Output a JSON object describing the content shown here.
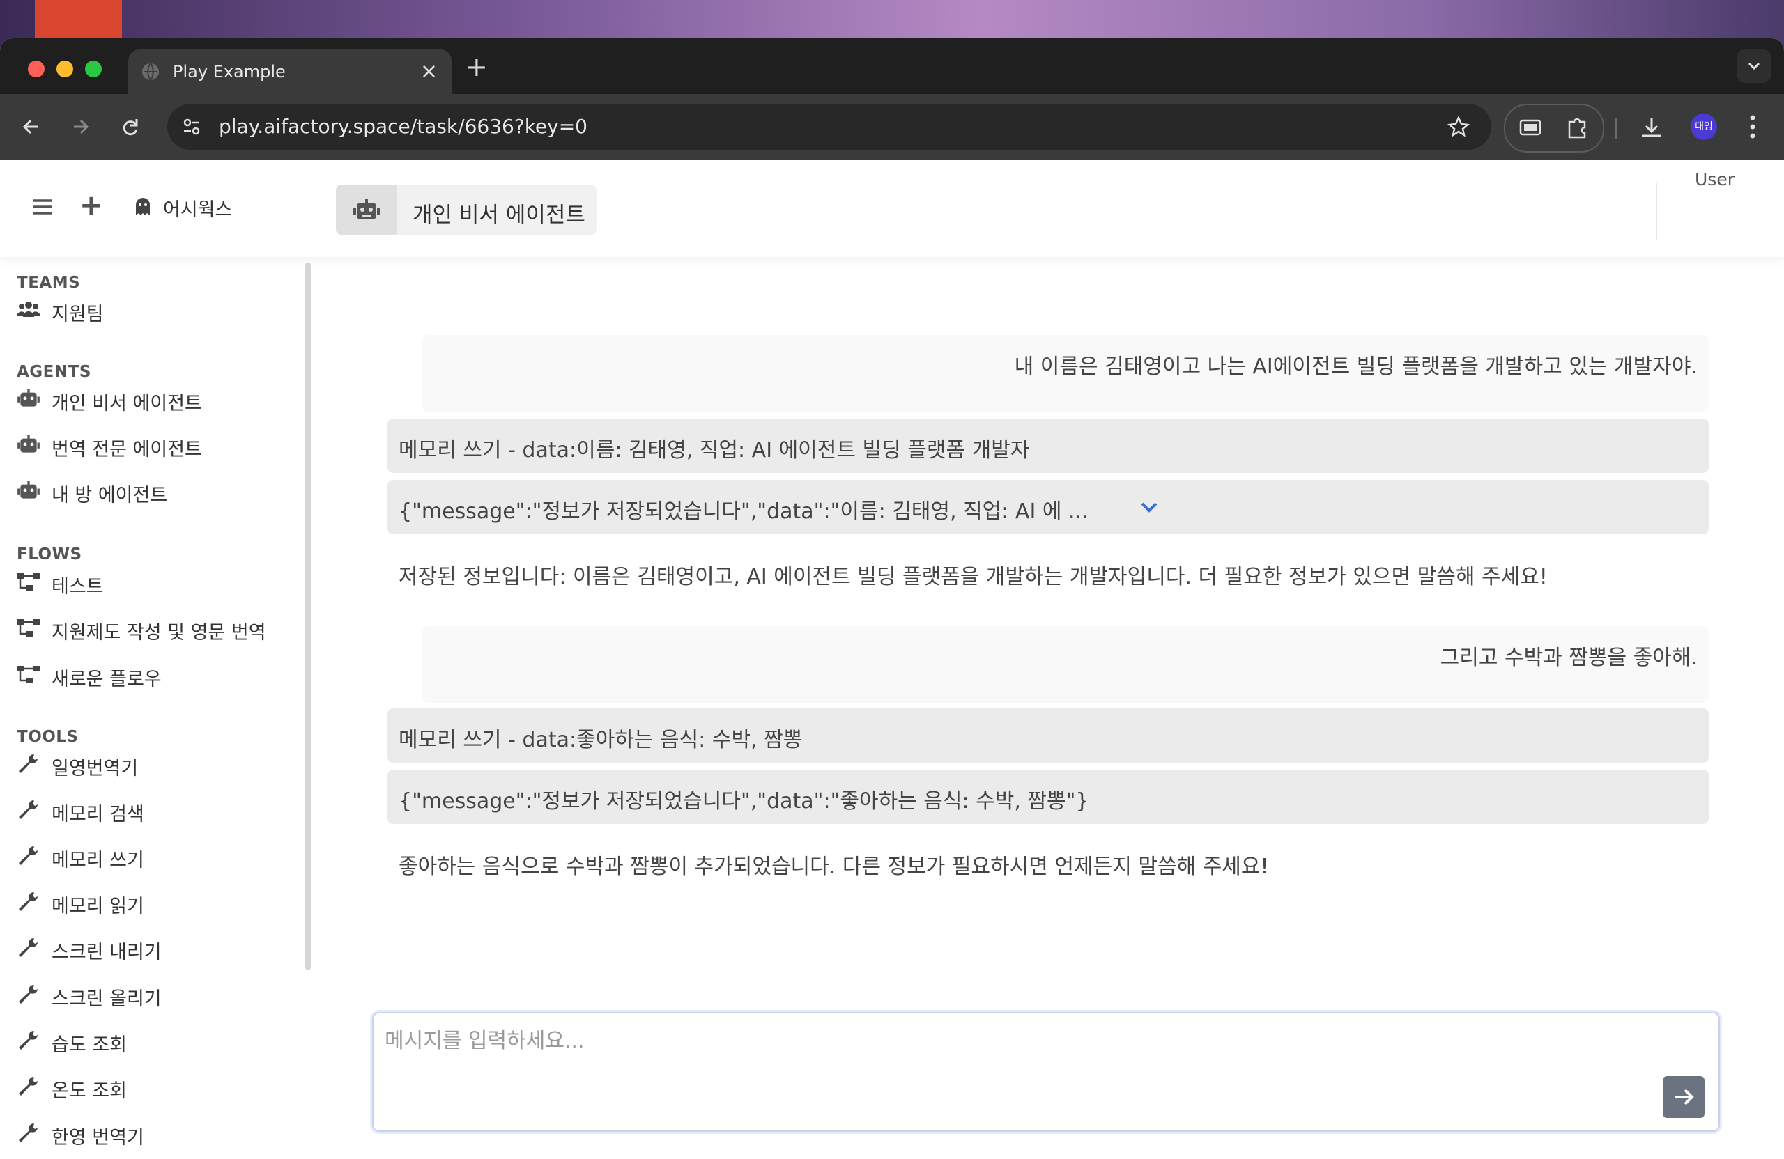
{
  "browser": {
    "tab_title": "Play Example",
    "tab_close": "×",
    "new_tab": "+",
    "url": "play.aifactory.space/task/6636?key=0",
    "profile_initials": "태영"
  },
  "header": {
    "workspace_name": "어시웍스",
    "agent_name": "개인 비서 에이전트",
    "user_label": "User",
    "new_button": "+"
  },
  "sidebar": {
    "teams_heading": "TEAMS",
    "teams": [
      {
        "label": "지원팀",
        "icon": "users-icon"
      }
    ],
    "agents_heading": "AGENTS",
    "agents": [
      {
        "label": "개인 비서 에이전트",
        "icon": "robot-icon"
      },
      {
        "label": "번역 전문 에이전트",
        "icon": "robot-icon"
      },
      {
        "label": "내 방 에이전트",
        "icon": "robot-icon"
      }
    ],
    "flows_heading": "FLOWS",
    "flows": [
      {
        "label": "테스트",
        "icon": "flow-icon"
      },
      {
        "label": "지원제도 작성 및 영문 번역",
        "icon": "flow-icon"
      },
      {
        "label": "새로운 플로우",
        "icon": "flow-icon"
      }
    ],
    "tools_heading": "TOOLS",
    "tools": [
      {
        "label": "일영번역기",
        "icon": "wrench-icon"
      },
      {
        "label": "메모리 검색",
        "icon": "wrench-icon"
      },
      {
        "label": "메모리 쓰기",
        "icon": "wrench-icon"
      },
      {
        "label": "메모리 읽기",
        "icon": "wrench-icon"
      },
      {
        "label": "스크린 내리기",
        "icon": "wrench-icon"
      },
      {
        "label": "스크린 올리기",
        "icon": "wrench-icon"
      },
      {
        "label": "습도 조회",
        "icon": "wrench-icon"
      },
      {
        "label": "온도 조회",
        "icon": "wrench-icon"
      },
      {
        "label": "한영 번역기",
        "icon": "wrench-icon"
      }
    ]
  },
  "chat": {
    "messages": [
      {
        "role": "user",
        "text": "내 이름은 김태영이고 나는 AI에이전트 빌딩 플랫폼을 개발하고 있는 개발자야."
      },
      {
        "role": "tool_call",
        "text": "메모리 쓰기 - data:이름: 김태영, 직업: AI 에이전트 빌딩 플랫폼 개발자"
      },
      {
        "role": "tool_result",
        "text": "{\"message\":\"정보가 저장되었습니다\",\"data\":\"이름: 김태영, 직업: AI 에 ...",
        "collapsed": true
      },
      {
        "role": "assistant",
        "text": "저장된 정보입니다: 이름은 김태영이고, AI 에이전트 빌딩 플랫폼을 개발하는 개발자입니다. 더 필요한 정보가 있으면 말씀해 주세요!"
      },
      {
        "role": "user",
        "text": "그리고 수박과 짬뽕을 좋아해."
      },
      {
        "role": "tool_call",
        "text": "메모리 쓰기 - data:좋아하는 음식: 수박, 짬뽕"
      },
      {
        "role": "tool_result",
        "text": "{\"message\":\"정보가 저장되었습니다\",\"data\":\"좋아하는 음식: 수박, 짬뽕\"}"
      },
      {
        "role": "assistant",
        "text": "좋아하는 음식으로 수박과 짬뽕이 추가되었습니다. 다른 정보가 필요하시면 언제든지 말씀해 주세요!"
      }
    ],
    "input_placeholder": "메시지를 입력하세요...",
    "input_value": ""
  },
  "colors": {
    "accent_chevron": "#3b6fd8",
    "send_button": "#6b7280",
    "profile_avatar": "#4b3bd6"
  }
}
